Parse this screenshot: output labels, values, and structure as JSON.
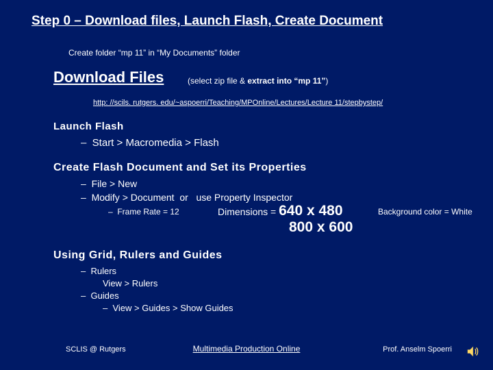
{
  "title": "Step 0 – Download files, Launch Flash, Create Document",
  "createFolder": "Create folder “mp 11” in “My Documents” folder",
  "downloadFiles": "Download Files",
  "downloadFilesSubPrefix": "(select zip file & ",
  "downloadFilesSubBold": "extract into “mp 11”",
  "downloadFilesSubSuffix": ")",
  "url": "http: //scils. rutgers. edu/~aspoerri/Teaching/MPOnline/Lectures/Lecture 11/stepbystep/",
  "launchFlash": "Launch Flash",
  "launchItem": "–  Start > Macromedia > Flash",
  "createDocHeading": "Create Flash Document and Set its Properties",
  "cdL1": "–  File > New",
  "cdL2": "–  Modify > Document  or   use Property Inspector",
  "frameRate": "–  Frame Rate = 12",
  "dimLabel": "Dimensions = ",
  "dimA": "640 x 480",
  "dimB": "800 x 600",
  "bgColor": "Background color = White",
  "gridHeading": "Using Grid, Rulers and Guides",
  "gRulers": "–  Rulers",
  "gViewRulers": "View > Rulers",
  "gGuides": "–  Guides",
  "gShowGuides": "–  View > Guides > Show Guides",
  "footerLeft": "SCLIS @ Rutgers",
  "footerCenter": "Multimedia Production Online",
  "footerRight": "Prof. Anselm Spoerri"
}
